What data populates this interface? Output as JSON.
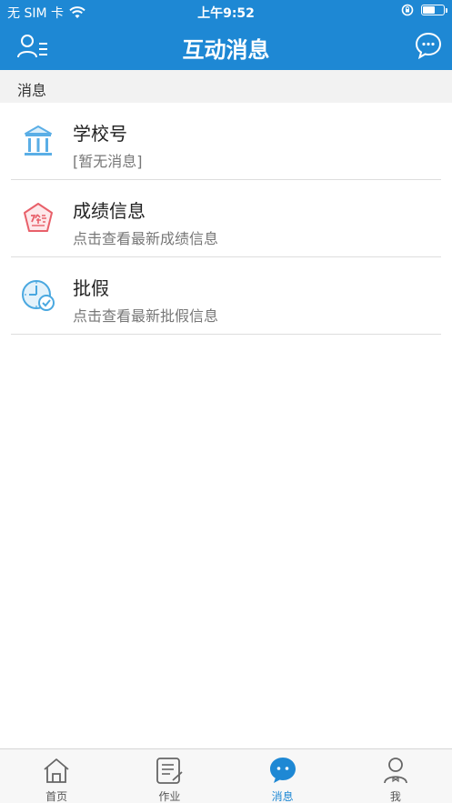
{
  "status_bar": {
    "carrier": "无 SIM 卡",
    "time": "上午9:52"
  },
  "nav": {
    "title": "互动消息"
  },
  "section": {
    "title": "消息"
  },
  "messages": [
    {
      "name": "学校号",
      "subtitle": "[暂无消息]",
      "icon": "school-building-icon"
    },
    {
      "name": "成绩信息",
      "subtitle": "点击查看最新成绩信息",
      "icon": "score-badge-icon"
    },
    {
      "name": "批假",
      "subtitle": "点击查看最新批假信息",
      "icon": "leave-clock-icon"
    }
  ],
  "tabs": [
    {
      "label": "首页",
      "icon": "home-icon",
      "active": false
    },
    {
      "label": "作业",
      "icon": "homework-icon",
      "active": false
    },
    {
      "label": "消息",
      "icon": "message-icon",
      "active": true
    },
    {
      "label": "我",
      "icon": "profile-icon",
      "active": false
    }
  ],
  "colors": {
    "primary": "#1e88d4",
    "school_icon": "#5aaee6",
    "score_icon": "#e8606a",
    "leave_icon": "#4aa8e0"
  }
}
